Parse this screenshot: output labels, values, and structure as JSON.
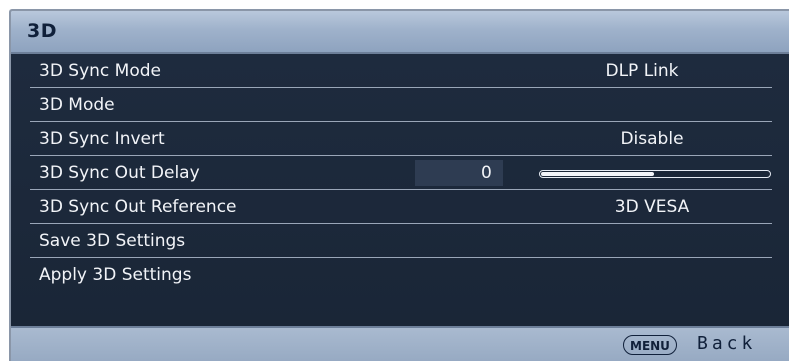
{
  "header": {
    "title": "3D"
  },
  "menu": {
    "items": [
      {
        "label": "3D Sync Mode",
        "value": "DLP Link"
      },
      {
        "label": "3D Mode",
        "value": ""
      },
      {
        "label": "3D Sync Invert",
        "value": "Disable"
      },
      {
        "label": "3D Sync Out Delay",
        "value": "0",
        "slider_level": 0.5
      },
      {
        "label": "3D Sync Out Reference",
        "value": "3D VESA"
      },
      {
        "label": "Save 3D Settings",
        "value": ""
      },
      {
        "label": "Apply 3D Settings",
        "value": ""
      }
    ]
  },
  "footer": {
    "menu_button_label": "MENU",
    "back_label": "Back"
  },
  "colors": {
    "header_bg": "#a3b5cd",
    "body_bg": "#1c2839",
    "text": "#f2f4f8",
    "footer_text": "#10203a"
  },
  "icons": {
    "menu_button": "menu-pill-icon"
  }
}
